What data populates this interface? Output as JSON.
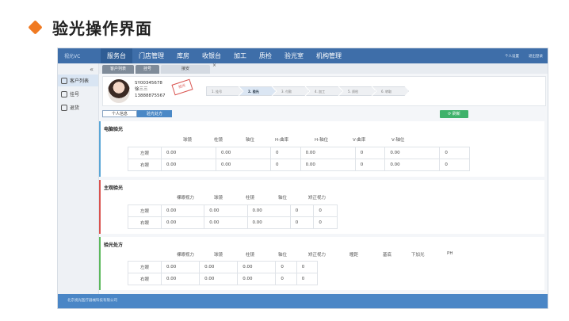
{
  "slide": {
    "title": "验光操作界面"
  },
  "topnav": {
    "brand": "视光VC",
    "items": [
      "服务台",
      "门店管理",
      "库房",
      "收银台",
      "加工",
      "质检",
      "验光室",
      "机构管理"
    ],
    "active_index": 0,
    "right_links": [
      "个人设置",
      "退出登录"
    ]
  },
  "sidebar": {
    "collapse": "«",
    "items": [
      {
        "label": "客户列表",
        "icon": "users-icon"
      },
      {
        "label": "挂号",
        "icon": "id-card-icon"
      },
      {
        "label": "退货",
        "icon": "return-icon"
      }
    ]
  },
  "tabs": [
    {
      "label": "客户列表"
    },
    {
      "label": "挂号"
    },
    {
      "label": "接安",
      "close": "×"
    }
  ],
  "patient": {
    "id": "SY00345678",
    "name": "徐三三",
    "phone": "13888875567",
    "stamp": "验光"
  },
  "steps": [
    "1. 挂号",
    "2. 验光",
    "3. 付款",
    "4. 加工",
    "5. 质检",
    "6. 转取"
  ],
  "active_step": 1,
  "subtabs": [
    "个人信息",
    "验光处方"
  ],
  "refresh_label": "刷新",
  "sec1": {
    "title": "电脑验光",
    "headers": [
      "球镜",
      "柱镜",
      "轴位",
      "H-曲率",
      "H-轴位",
      "V-曲率",
      "V-轴位"
    ],
    "rows": [
      {
        "eye": "左眼",
        "vals": [
          "0.00",
          "0.00",
          "0",
          "0.00",
          "0",
          "0.00",
          "0"
        ]
      },
      {
        "eye": "右眼",
        "vals": [
          "0.00",
          "0.00",
          "0",
          "0.00",
          "0",
          "0.00",
          "0"
        ]
      }
    ]
  },
  "sec2": {
    "title": "主观验光",
    "headers": [
      "裸眼视力",
      "球镜",
      "柱镜",
      "轴位",
      "矫正视力"
    ],
    "rows": [
      {
        "eye": "左眼",
        "vals": [
          "0.00",
          "0.00",
          "0.00",
          "0",
          "0"
        ]
      },
      {
        "eye": "右眼",
        "vals": [
          "0.00",
          "0.00",
          "0.00",
          "0",
          "0"
        ]
      }
    ]
  },
  "sec3": {
    "title": "验光处方",
    "headers": [
      "裸眼视力",
      "球镜",
      "柱镜",
      "轴位",
      "矫正视力",
      "瞳距",
      "基底",
      "下加光",
      "PH"
    ],
    "rows": [
      {
        "eye": "左眼",
        "vals": [
          "0.00",
          "0.00",
          "0.00",
          "0",
          "0",
          "",
          "",
          "",
          ""
        ]
      },
      {
        "eye": "右眼",
        "vals": [
          "0.00",
          "0.00",
          "0.00",
          "0",
          "0",
          "",
          "",
          "",
          ""
        ]
      }
    ]
  },
  "footer": {
    "text": "北京视光医疗器械科技有限公司"
  }
}
